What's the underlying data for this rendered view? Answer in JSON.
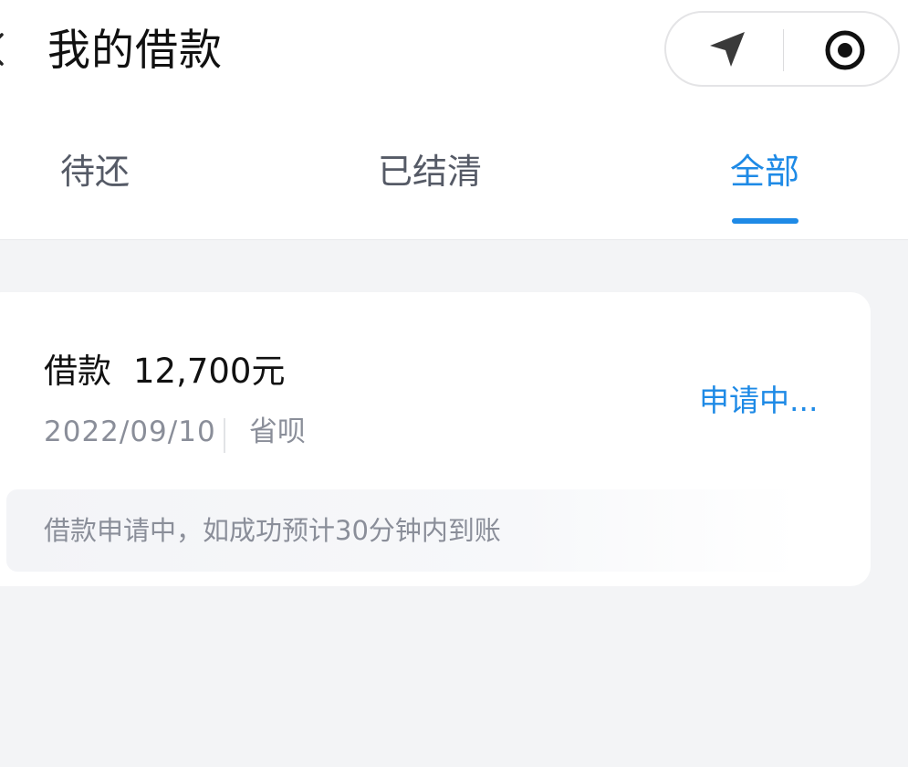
{
  "header": {
    "title": "我的借款",
    "icons": [
      "back-icon",
      "navigation-arrow-icon",
      "target-icon"
    ]
  },
  "tabs": [
    {
      "label": "待还",
      "active": false
    },
    {
      "label": "已结清",
      "active": false
    },
    {
      "label": "全部",
      "active": true
    }
  ],
  "loan": {
    "label": "借款",
    "amount": "12,700元",
    "date": "2022/09/10",
    "product": "省呗",
    "status": "申请中...",
    "notice": "借款申请中，如成功预计30分钟内到账"
  },
  "colors": {
    "accent": "#1e8ae6",
    "background": "#f3f4f6",
    "muted_text": "#8a8e99",
    "title_text": "#111111"
  }
}
